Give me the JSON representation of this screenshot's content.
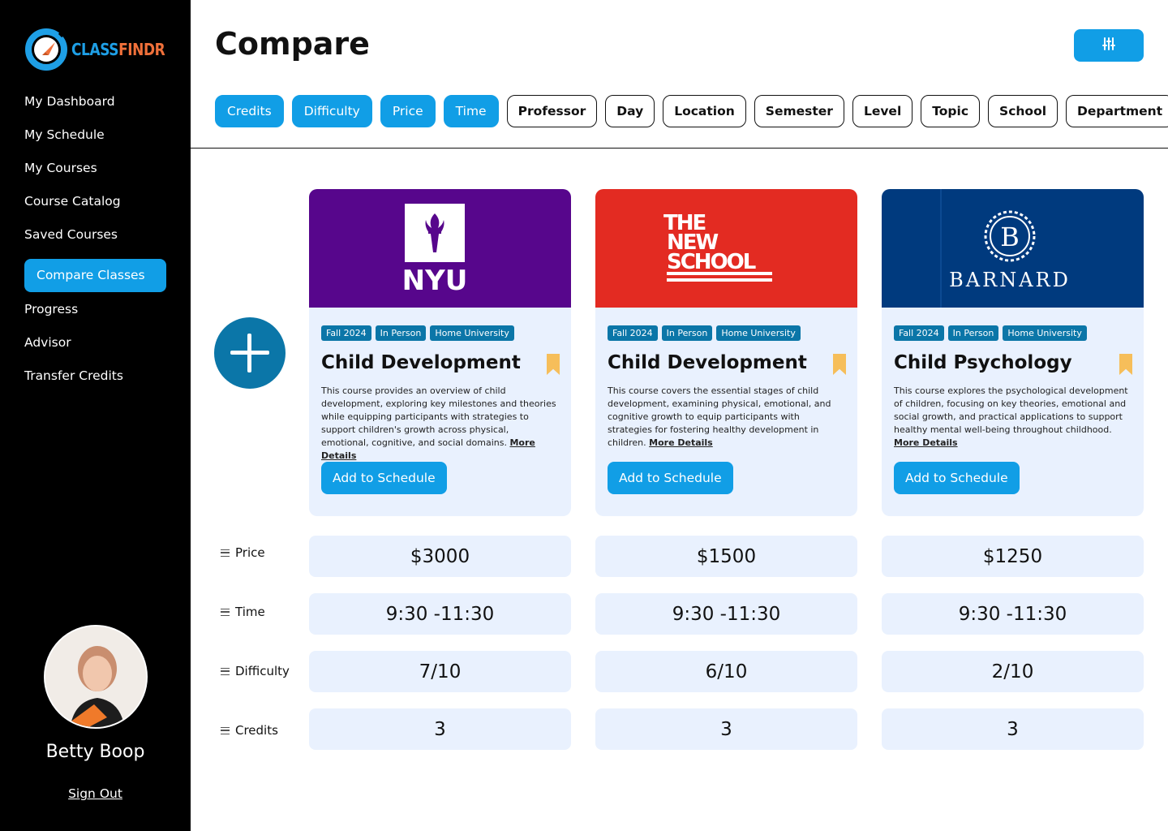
{
  "brand": {
    "part1": "CLASS",
    "part2": "FINDR"
  },
  "nav": [
    {
      "label": "My Dashboard"
    },
    {
      "label": "My Schedule"
    },
    {
      "label": "My Courses"
    },
    {
      "label": "Course Catalog"
    },
    {
      "label": "Saved Courses"
    },
    {
      "label": "Compare Classes",
      "active": true
    },
    {
      "label": "Progress"
    },
    {
      "label": "Advisor"
    },
    {
      "label": "Transfer Credits"
    }
  ],
  "profile": {
    "name": "Betty Boop",
    "sign_out": "Sign Out"
  },
  "header": {
    "title": "Compare",
    "settings_icon": "sliders-icon"
  },
  "filters": [
    {
      "label": "Credits",
      "selected": true
    },
    {
      "label": "Difficulty",
      "selected": true
    },
    {
      "label": "Price",
      "selected": true
    },
    {
      "label": "Time",
      "selected": true
    },
    {
      "label": "Professor",
      "selected": false
    },
    {
      "label": "Day",
      "selected": false
    },
    {
      "label": "Location",
      "selected": false
    },
    {
      "label": "Semester",
      "selected": false
    },
    {
      "label": "Level",
      "selected": false
    },
    {
      "label": "Topic",
      "selected": false
    },
    {
      "label": "School",
      "selected": false
    },
    {
      "label": "Department",
      "selected": false
    }
  ],
  "courses": [
    {
      "school_logo": "NYU",
      "banner_color": "#57068c",
      "tags": [
        "Fall 2024",
        "In Person",
        "Home University"
      ],
      "title": "Child Development",
      "description": "This course provides an overview of child development, exploring key milestones and theories while equipping participants with strategies to support children's growth across physical, emotional, cognitive, and social domains.",
      "more": "More Details",
      "add_label": "Add to Schedule",
      "price": "$3000",
      "time": "9:30 -11:30",
      "difficulty": "7/10",
      "credits": "3"
    },
    {
      "school_logo_lines": [
        "THE",
        "NEW",
        "SCHOOL"
      ],
      "banner_color": "#e32b22",
      "tags": [
        "Fall 2024",
        "In Person",
        "Home University"
      ],
      "title": "Child Development",
      "description": "This course covers the essential stages of child development, examining physical, emotional, and cognitive growth to equip participants with strategies for fostering healthy development in children.",
      "more": "More Details",
      "add_label": "Add to Schedule",
      "price": "$1500",
      "time": "9:30 -11:30",
      "difficulty": "6/10",
      "credits": "3"
    },
    {
      "school_logo": "BARNARD",
      "school_seal_letter": "B",
      "banner_color": "#003a7e",
      "tags": [
        "Fall 2024",
        "In Person",
        "Home University"
      ],
      "title": "Child Psychology",
      "description": "This course explores the psychological development of children, focusing on key theories, emotional and social growth, and practical applications to support healthy mental well-being throughout childhood.",
      "more": "More Details",
      "add_label": "Add to Schedule",
      "price": "$1250",
      "time": "9:30 -11:30",
      "difficulty": "2/10",
      "credits": "3"
    }
  ],
  "rows": [
    {
      "label": "Price"
    },
    {
      "label": "Time"
    },
    {
      "label": "Difficulty"
    },
    {
      "label": "Credits"
    }
  ]
}
